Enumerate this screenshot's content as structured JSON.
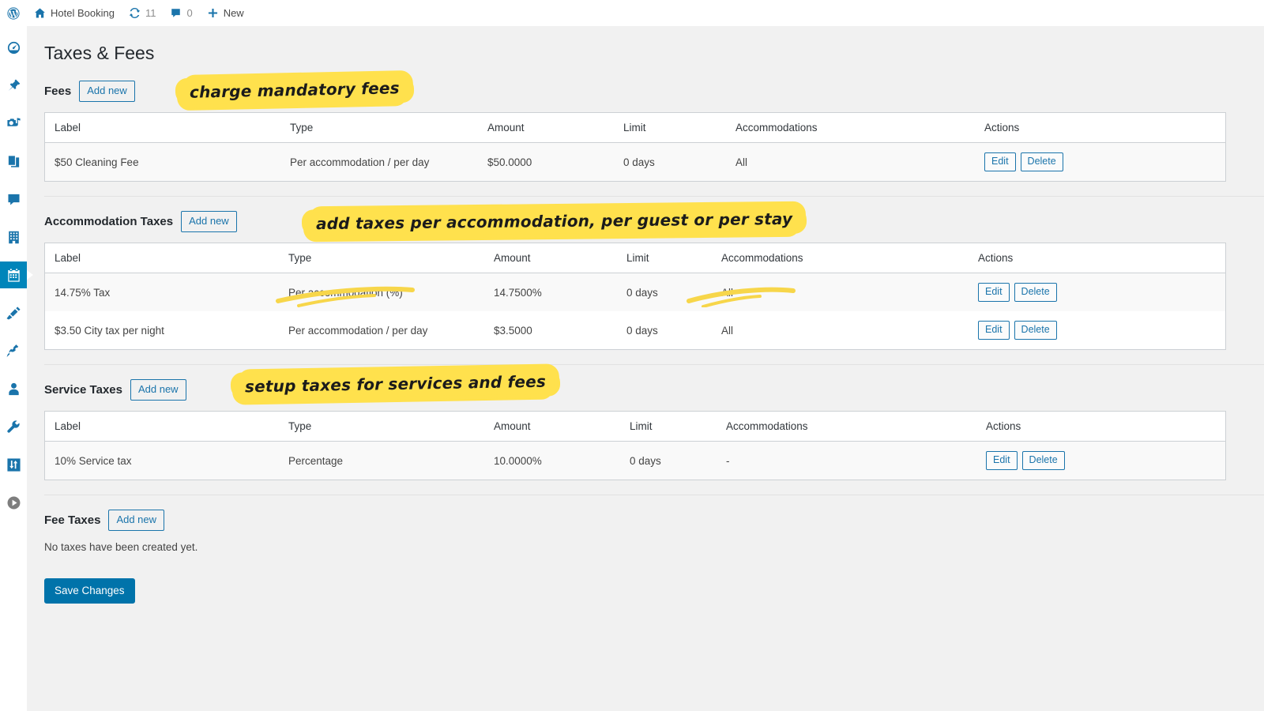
{
  "adminbar": {
    "logo_icon": "wordpress-logo-icon",
    "site_icon": "home-icon",
    "site_name": "Hotel Booking",
    "updates_icon": "updates-icon",
    "updates_count": "11",
    "comments_icon": "comment-bubble-icon",
    "comments_count": "0",
    "new_icon": "plus-icon",
    "new_label": "New"
  },
  "sidebar": {
    "items": [
      {
        "name": "dashboard",
        "icon": "dashboard-gauge-icon",
        "current": false
      },
      {
        "name": "posts",
        "icon": "pushpin-icon",
        "current": false
      },
      {
        "name": "media",
        "icon": "media-camera-music-icon",
        "current": false
      },
      {
        "name": "pages",
        "icon": "pages-stack-icon",
        "current": false
      },
      {
        "name": "comments",
        "icon": "comment-bubble-icon",
        "current": false
      },
      {
        "name": "hotel",
        "icon": "building-icon",
        "current": false
      },
      {
        "name": "bookings",
        "icon": "calendar-icon",
        "current": true
      },
      {
        "name": "appearance",
        "icon": "paintbrush-icon",
        "current": false
      },
      {
        "name": "plugins",
        "icon": "plug-icon",
        "current": false
      },
      {
        "name": "users",
        "icon": "user-icon",
        "current": false
      },
      {
        "name": "tools",
        "icon": "wrench-icon",
        "current": false
      },
      {
        "name": "settings",
        "icon": "settings-sliders-icon",
        "current": false
      },
      {
        "name": "collapse-menu",
        "icon": "collapse-arrow-icon",
        "current": false
      }
    ]
  },
  "page": {
    "title": "Taxes & Fees",
    "save_label": "Save Changes",
    "add_new_label": "Add new",
    "edit_label": "Edit",
    "delete_label": "Delete",
    "empty_message": "No taxes have been created yet."
  },
  "columns": [
    "Label",
    "Type",
    "Amount",
    "Limit",
    "Accommodations",
    "Actions"
  ],
  "sections": [
    {
      "id": "fees",
      "heading": "Fees",
      "rows": [
        {
          "label": "$50 Cleaning Fee",
          "type": "Per accommodation / per day",
          "amount": "$50.0000",
          "limit": "0 days",
          "accommodations": "All"
        }
      ]
    },
    {
      "id": "accommodation-taxes",
      "heading": "Accommodation Taxes",
      "rows": [
        {
          "label": "14.75% Tax",
          "type": "Per accommodation (%)",
          "amount": "14.7500%",
          "limit": "0 days",
          "accommodations": "All"
        },
        {
          "label": "$3.50 City tax per night",
          "type": "Per accommodation / per day",
          "amount": "$3.5000",
          "limit": "0 days",
          "accommodations": "All"
        }
      ]
    },
    {
      "id": "service-taxes",
      "heading": "Service Taxes",
      "rows": [
        {
          "label": "10% Service tax",
          "type": "Percentage",
          "amount": "10.0000%",
          "limit": "0 days",
          "accommodations": "-"
        }
      ]
    },
    {
      "id": "fee-taxes",
      "heading": "Fee Taxes",
      "rows": []
    }
  ],
  "annotations": [
    {
      "id": "anno-fees",
      "text": "charge mandatory fees"
    },
    {
      "id": "anno-accommodation",
      "text": "add taxes per accommodation, per guest or per stay"
    },
    {
      "id": "anno-service",
      "text": "setup taxes for services and fees"
    }
  ],
  "colors": {
    "accent_blue": "#1a74ab",
    "primary_button": "#0073aa",
    "current_menu": "#0085ba",
    "highlighter_yellow": "#ffe14d",
    "page_background": "#f1f1f1"
  }
}
